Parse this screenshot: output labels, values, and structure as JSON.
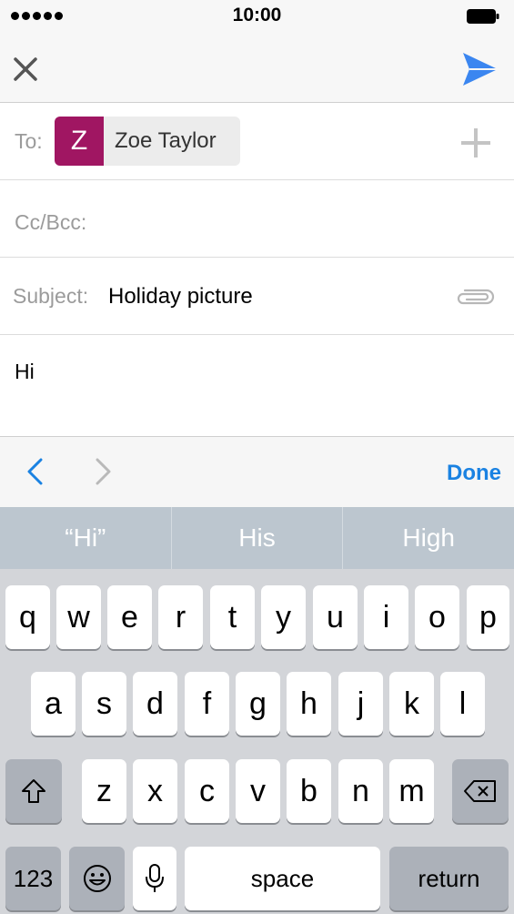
{
  "status_bar": {
    "time": "10:00",
    "signal_dots": 5
  },
  "nav": {
    "close_icon": "close-icon",
    "send_icon": "send-icon"
  },
  "to_row": {
    "label": "To:",
    "recipient_initial": "Z",
    "recipient_name": "Zoe Taylor",
    "add_icon": "plus-icon"
  },
  "cc_row": {
    "label": "Cc/Bcc:"
  },
  "subject_row": {
    "label": "Subject:",
    "value": "Holiday picture",
    "attach_icon": "paperclip-icon"
  },
  "body": {
    "text": "Hi"
  },
  "toolbar": {
    "prev_icon": "chevron-left-icon",
    "next_icon": "chevron-right-icon",
    "done_label": "Done"
  },
  "suggestions": [
    "“Hi”",
    "His",
    "High"
  ],
  "keyboard": {
    "row1": [
      "q",
      "w",
      "e",
      "r",
      "t",
      "y",
      "u",
      "i",
      "o",
      "p"
    ],
    "row2": [
      "a",
      "s",
      "d",
      "f",
      "g",
      "h",
      "j",
      "k",
      "l"
    ],
    "row3": [
      "z",
      "x",
      "c",
      "v",
      "b",
      "n",
      "m"
    ],
    "numbers_label": "123",
    "space_label": "space",
    "return_label": "return",
    "shift_icon": "shift-icon",
    "delete_icon": "delete-icon",
    "emoji_icon": "emoji-icon",
    "mic_icon": "microphone-icon"
  },
  "colors": {
    "accent": "#1a82e2",
    "avatar": "#a01662",
    "suggestion_bar": "#bcc6cf",
    "keyboard_bg": "#d3d5d9"
  }
}
